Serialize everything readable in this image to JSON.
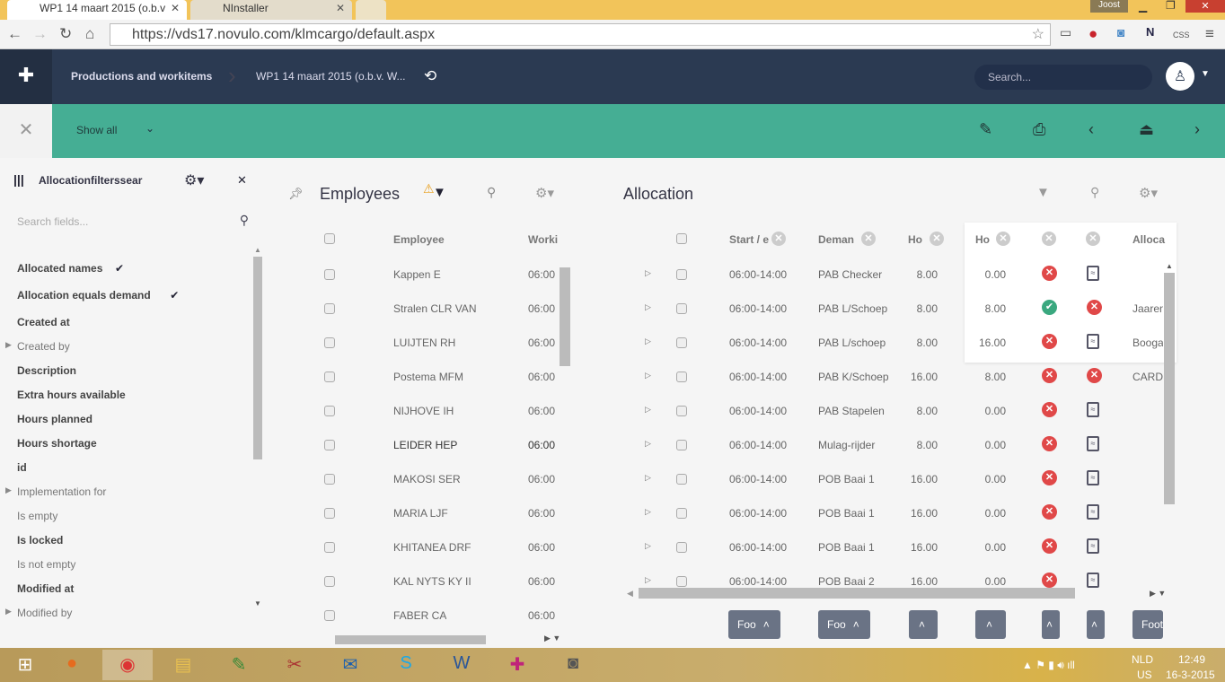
{
  "browser": {
    "tabs": [
      {
        "title": "WP1 14 maart 2015 (o.b.v"
      },
      {
        "title": "NInstaller"
      }
    ],
    "user": "Joost",
    "url": "https://vds17.novulo.com/klmcargo/default.aspx"
  },
  "header": {
    "breadcrumb": [
      "Productions and workitems",
      "WP1 14 maart 2015 (o.b.v. W..."
    ],
    "search_placeholder": "Search..."
  },
  "toolbar": {
    "show_all": "Show all"
  },
  "filters": {
    "title": "Allocationfilterssear",
    "search_placeholder": "Search fields...",
    "items": [
      {
        "label": "Allocated names",
        "bold": true,
        "checked": true
      },
      {
        "label": "Allocation equals demand",
        "bold": true,
        "checked": true
      },
      {
        "label": "Created at",
        "bold": true
      },
      {
        "label": "Created by",
        "bold": false,
        "expand": true
      },
      {
        "label": "Description",
        "bold": true
      },
      {
        "label": "Extra hours available",
        "bold": true
      },
      {
        "label": "Hours planned",
        "bold": true
      },
      {
        "label": "Hours shortage",
        "bold": true
      },
      {
        "label": "id",
        "bold": true
      },
      {
        "label": "Implementation for",
        "bold": false,
        "expand": true
      },
      {
        "label": "Is empty",
        "bold": false
      },
      {
        "label": "Is locked",
        "bold": true
      },
      {
        "label": "Is not empty",
        "bold": false
      },
      {
        "label": "Modified at",
        "bold": true
      },
      {
        "label": "Modified by",
        "bold": false,
        "expand": true
      }
    ]
  },
  "employees": {
    "title": "Employees",
    "columns": [
      "Employee",
      "Worki"
    ],
    "rows": [
      [
        "Kappen E",
        "06:00"
      ],
      [
        "Stralen CLR VAN",
        "06:00"
      ],
      [
        "LUIJTEN RH",
        "06:00"
      ],
      [
        "Postema MFM",
        "06:00"
      ],
      [
        "NIJHOVE IH",
        "06:00"
      ],
      [
        "LEIDER HEP",
        "06:00"
      ],
      [
        "MAKOSI SER",
        "06:00"
      ],
      [
        "MARIA LJF",
        "06:00"
      ],
      [
        "KHITANEA DRF",
        "06:00"
      ],
      [
        "KAL NYTS KY II",
        "06:00"
      ],
      [
        "FABER CA",
        "06:00"
      ]
    ]
  },
  "allocation": {
    "title": "Allocation",
    "columns": [
      "Start / e",
      "Deman",
      "Ho",
      "Ho",
      "",
      "",
      "Alloca"
    ],
    "rows": [
      {
        "start": "06:00-14:00",
        "demand": "PAB Checker",
        "h1": "8.00",
        "h2": "0.00",
        "status": "x",
        "doc": "doc",
        "alloc": ""
      },
      {
        "start": "06:00-14:00",
        "demand": "PAB L/Schoep",
        "h1": "8.00",
        "h2": "8.00",
        "status": "check",
        "doc": "x",
        "alloc": "Jaaren"
      },
      {
        "start": "06:00-14:00",
        "demand": "PAB L/schoep",
        "h1": "8.00",
        "h2": "16.00",
        "status": "x",
        "doc": "doc",
        "alloc": "Booga"
      },
      {
        "start": "06:00-14:00",
        "demand": "PAB K/Schoep",
        "h1": "16.00",
        "h2": "8.00",
        "status": "x",
        "doc": "x",
        "alloc": "CARD"
      },
      {
        "start": "06:00-14:00",
        "demand": "PAB Stapelen",
        "h1": "8.00",
        "h2": "0.00",
        "status": "x",
        "doc": "doc",
        "alloc": ""
      },
      {
        "start": "06:00-14:00",
        "demand": "Mulag-rijder",
        "h1": "8.00",
        "h2": "0.00",
        "status": "x",
        "doc": "doc",
        "alloc": ""
      },
      {
        "start": "06:00-14:00",
        "demand": "POB Baai 1",
        "h1": "16.00",
        "h2": "0.00",
        "status": "x",
        "doc": "doc",
        "alloc": ""
      },
      {
        "start": "06:00-14:00",
        "demand": "POB Baai 1",
        "h1": "16.00",
        "h2": "0.00",
        "status": "x",
        "doc": "doc",
        "alloc": ""
      },
      {
        "start": "06:00-14:00",
        "demand": "POB Baai 1",
        "h1": "16.00",
        "h2": "0.00",
        "status": "x",
        "doc": "doc",
        "alloc": ""
      },
      {
        "start": "06:00-14:00",
        "demand": "POB Baai 2",
        "h1": "16.00",
        "h2": "0.00",
        "status": "x",
        "doc": "doc",
        "alloc": ""
      }
    ],
    "footers": [
      "Foo",
      "Foo",
      "",
      "",
      "",
      "",
      "Foot"
    ]
  },
  "taskbar": {
    "lang": "NLD",
    "layout": "US",
    "time": "12:49",
    "date": "16-3-2015"
  },
  "colors": {
    "header": "#2b3a52",
    "toolbar": "#45ae94",
    "error": "#e04848",
    "ok": "#3aa87f"
  }
}
